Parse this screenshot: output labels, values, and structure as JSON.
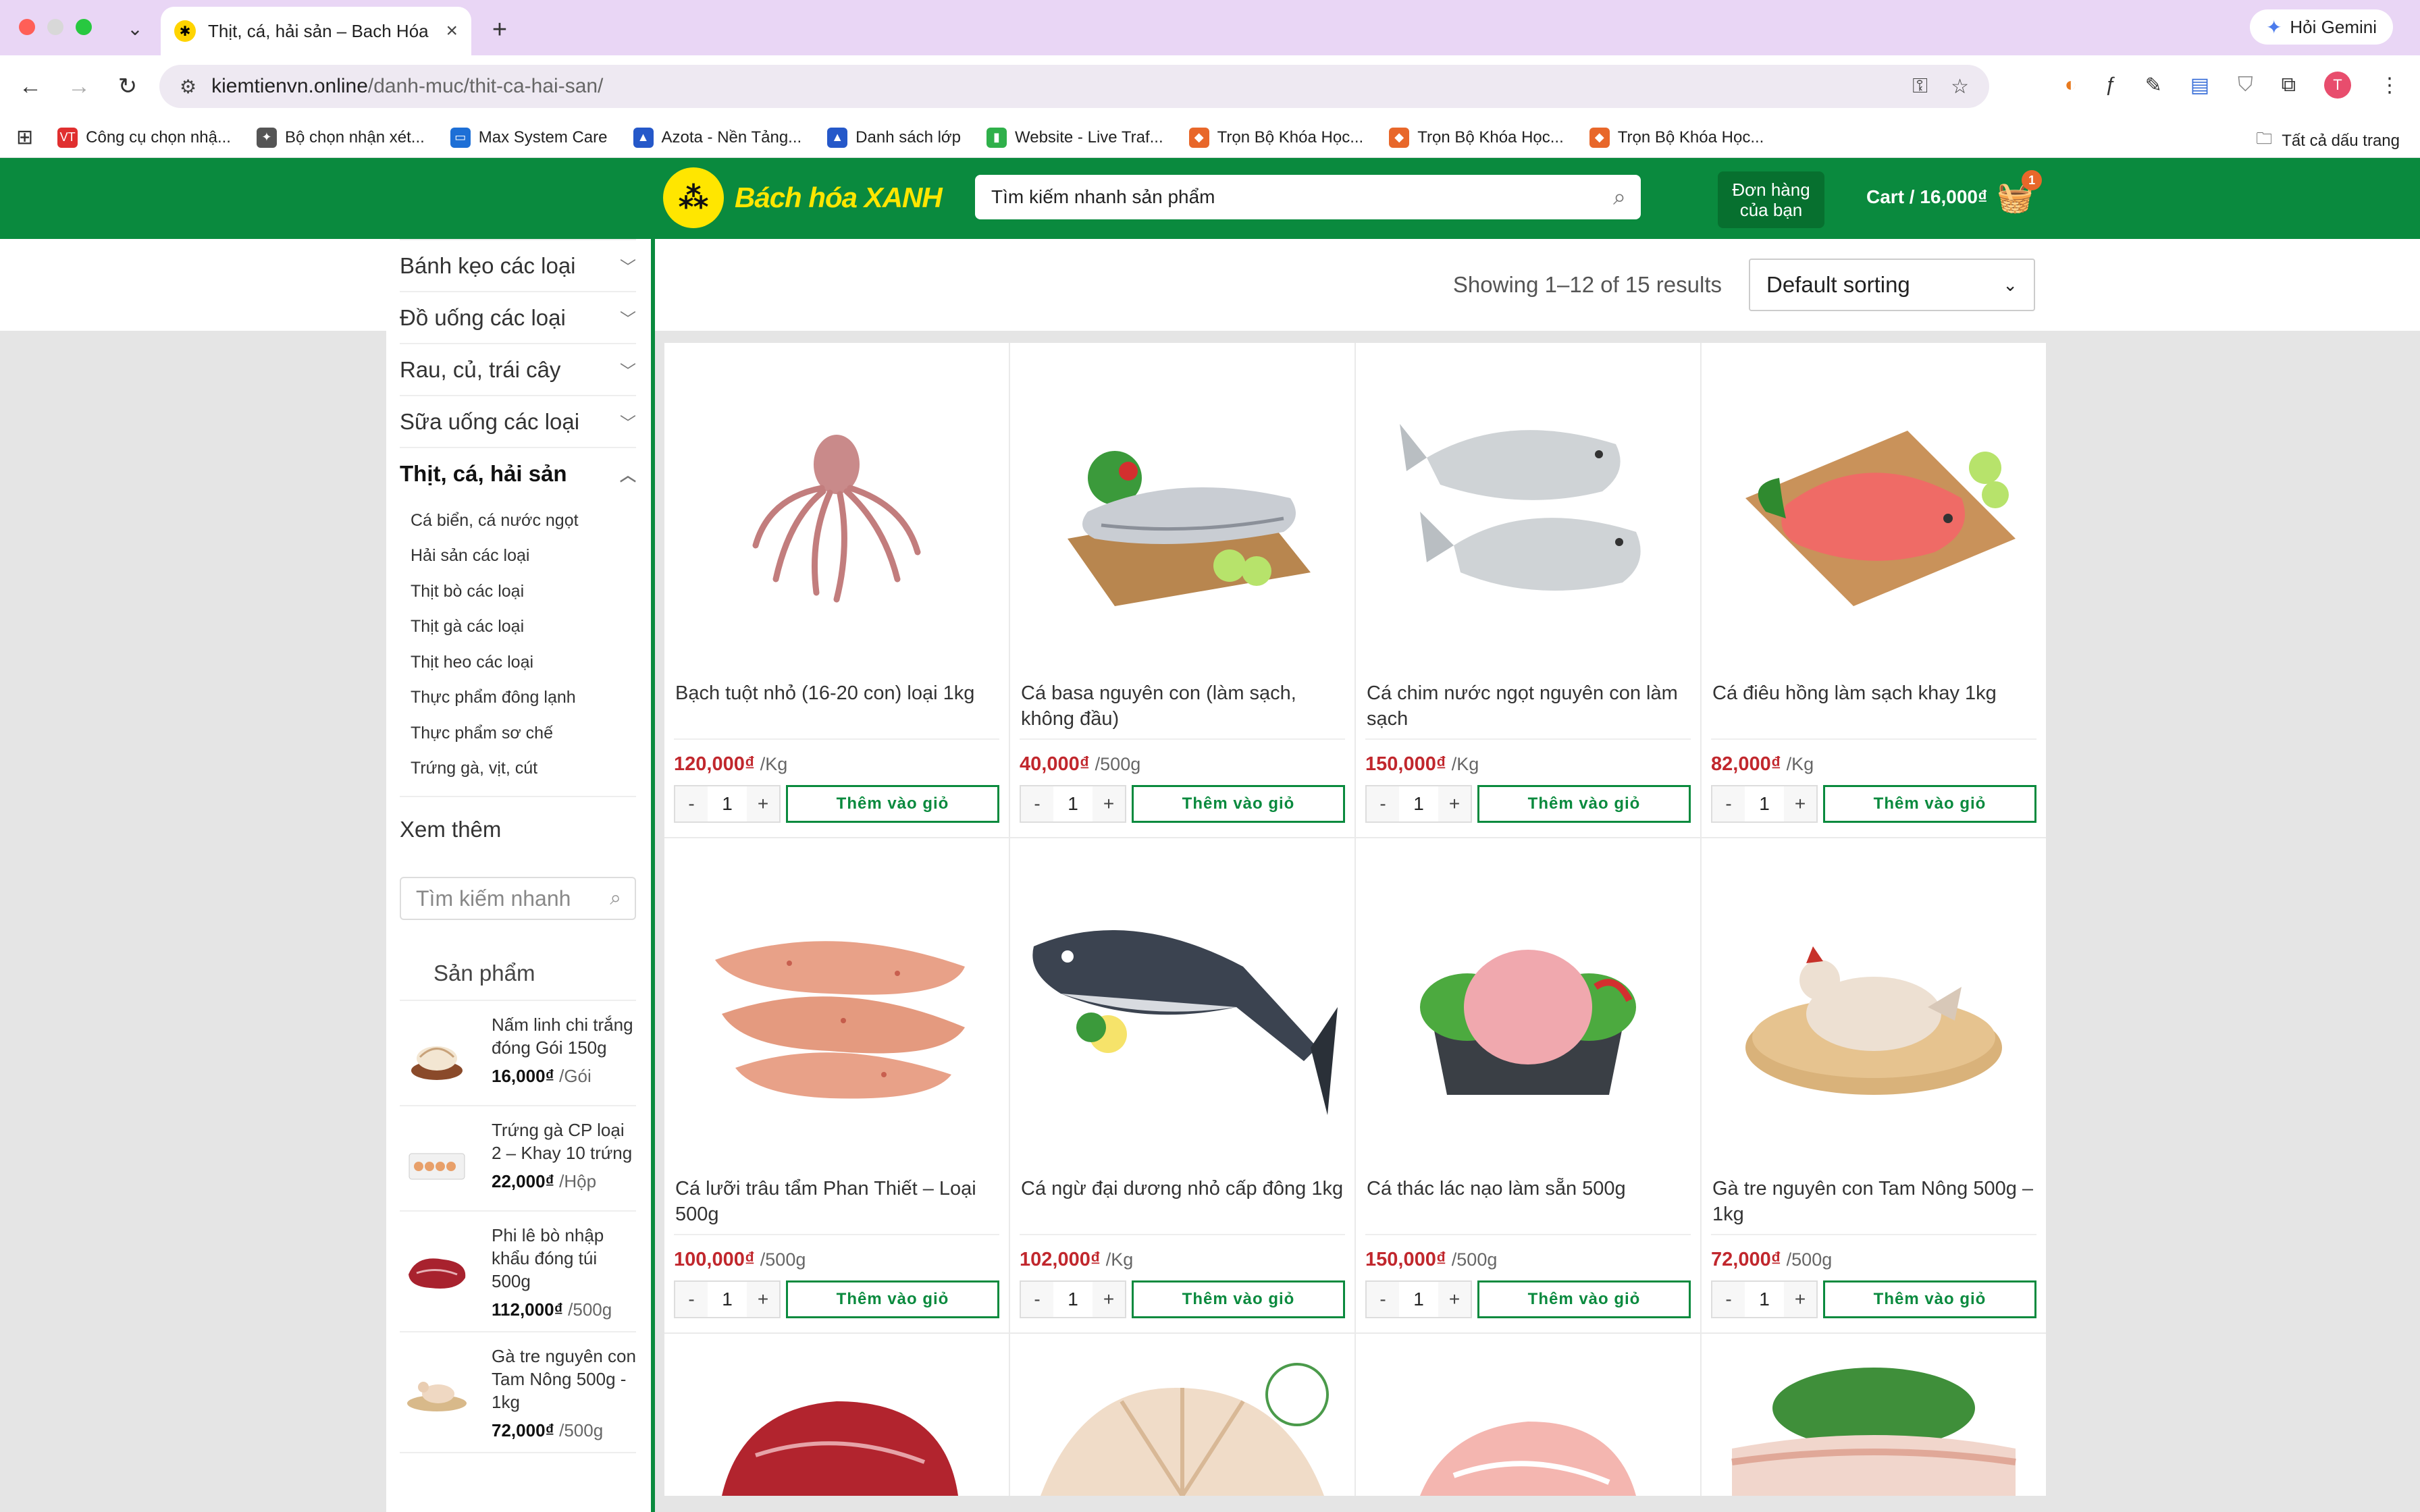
{
  "browser": {
    "tab_title": "Thịt, cá, hải sản – Bach Hóa X",
    "gemini_label": "Hỏi Gemini",
    "url_domain": "kiemtienvn.online",
    "url_path": "/danh-muc/thit-ca-hai-san/",
    "bookmarks": [
      {
        "label": "Công cụ chọn nhậ...",
        "icon": "vt-icon",
        "color": "#e02f2f"
      },
      {
        "label": "Bộ chọn nhận xét...",
        "icon": "cursor-icon",
        "color": "#555555"
      },
      {
        "label": "Max System Care",
        "icon": "maxsystem-icon",
        "color": "#1d6fd6"
      },
      {
        "label": "Azota - Nền Tảng...",
        "icon": "azota-icon",
        "color": "#2558c9"
      },
      {
        "label": "Danh sách lớp",
        "icon": "azota-icon",
        "color": "#2558c9"
      },
      {
        "label": "Website - Live Traf...",
        "icon": "chart-icon",
        "color": "#2fb04a"
      },
      {
        "label": "Trọn Bộ Khóa Học...",
        "icon": "course-icon",
        "color": "#e8672a"
      },
      {
        "label": "Trọn Bộ Khóa Học...",
        "icon": "course-icon",
        "color": "#e8672a"
      },
      {
        "label": "Trọn Bộ Khóa Học...",
        "icon": "course-icon",
        "color": "#e8672a"
      }
    ],
    "all_bookmarks": "Tất cả dấu trang"
  },
  "header": {
    "logo_text": "Bách hóa XANH",
    "search_placeholder": "Tìm kiếm nhanh sản phẩm",
    "orders_line1": "Đơn hàng",
    "orders_line2": "của bạn",
    "cart_label": "Cart / 16,000₫",
    "cart_count": "1"
  },
  "sidebar": {
    "categories": [
      "Bánh kẹo các loại",
      "Đồ uống các loại",
      "Rau, củ, trái cây",
      "Sữa uống các loại"
    ],
    "active_category": "Thịt, cá, hải sản",
    "subcategories": [
      "Cá biển, cá nước ngọt",
      "Hải sản các loại",
      "Thịt bò các loại",
      "Thịt gà các loại",
      "Thịt heo các loại",
      "Thực phẩm đông lạnh",
      "Thực phẩm sơ chế",
      "Trứng gà, vịt, cút"
    ],
    "more_label": "Xem thêm",
    "search_placeholder": "Tìm kiếm nhanh",
    "products_title": "Sản phẩm",
    "products": [
      {
        "name": "Nấm linh chi trắng đóng Gói 150g",
        "price": "16,000₫",
        "unit": "/Gói"
      },
      {
        "name": "Trứng gà CP loại 2 – Khay 10 trứng",
        "price": "22,000₫",
        "unit": "/Hộp"
      },
      {
        "name": "Phi lê bò nhập khẩu đóng túi 500g",
        "price": "112,000₫",
        "unit": "/500g"
      },
      {
        "name": "Gà tre nguyên con Tam Nông 500g - 1kg",
        "price": "72,000₫",
        "unit": "/500g"
      }
    ]
  },
  "listing": {
    "result_count": "Showing 1–12 of 15 results",
    "sort_value": "Default sorting",
    "add_label": "Thêm vào giỏ",
    "qty_default": "1",
    "products": [
      {
        "name": "Bạch tuột nhỏ (16-20 con) loại 1kg",
        "price": "120,000₫",
        "unit": "/Kg"
      },
      {
        "name": "Cá basa nguyên con (làm sạch, không đầu)",
        "price": "40,000₫",
        "unit": "/500g"
      },
      {
        "name": "Cá chim nước ngọt nguyên con làm sạch",
        "price": "150,000₫",
        "unit": "/Kg"
      },
      {
        "name": "Cá điêu hồng làm sạch khay 1kg",
        "price": "82,000₫",
        "unit": "/Kg"
      },
      {
        "name": "Cá lưỡi trâu tẩm Phan Thiết – Loại 500g",
        "price": "100,000₫",
        "unit": "/500g"
      },
      {
        "name": "Cá ngừ đại dương nhỏ cấp đông 1kg",
        "price": "102,000₫",
        "unit": "/Kg"
      },
      {
        "name": "Cá thác lác nạo làm sẵn 500g",
        "price": "150,000₫",
        "unit": "/500g"
      },
      {
        "name": "Gà tre nguyên con Tam Nông 500g – 1kg",
        "price": "72,000₫",
        "unit": "/500g"
      }
    ]
  }
}
